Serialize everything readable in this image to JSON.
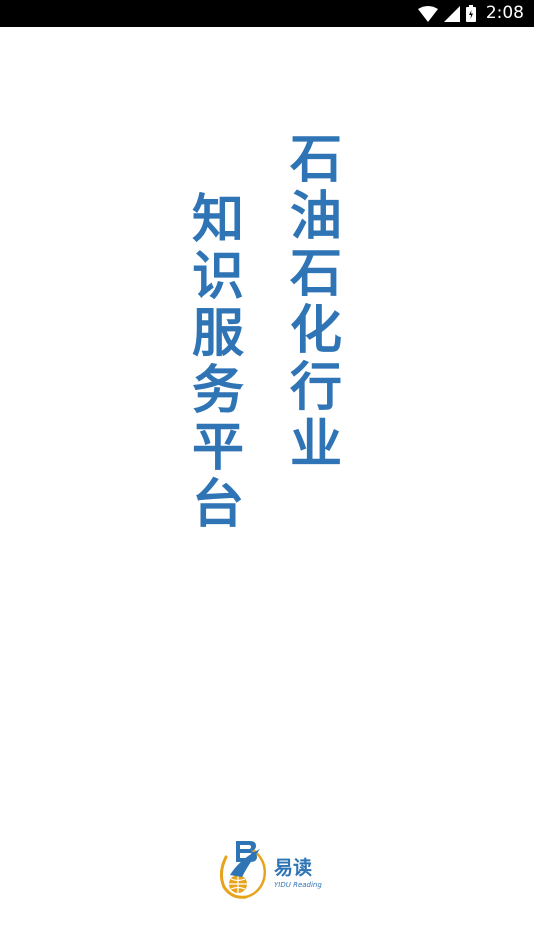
{
  "status_bar": {
    "time": "2:08",
    "icons": [
      "wifi-icon",
      "signal-icon",
      "battery-icon"
    ]
  },
  "splash": {
    "title_line_1": [
      "石",
      "油",
      "石",
      "化",
      "行",
      "业"
    ],
    "title_line_2": [
      "知",
      "识",
      "服",
      "务",
      "平",
      "台"
    ],
    "brand_name_cn": "易读",
    "brand_name_en": "YIDU Reading"
  },
  "colors": {
    "accent": "#2f74b5",
    "logo_orange": "#e8a31c",
    "status_bar_bg": "#000000",
    "background": "#ffffff"
  }
}
